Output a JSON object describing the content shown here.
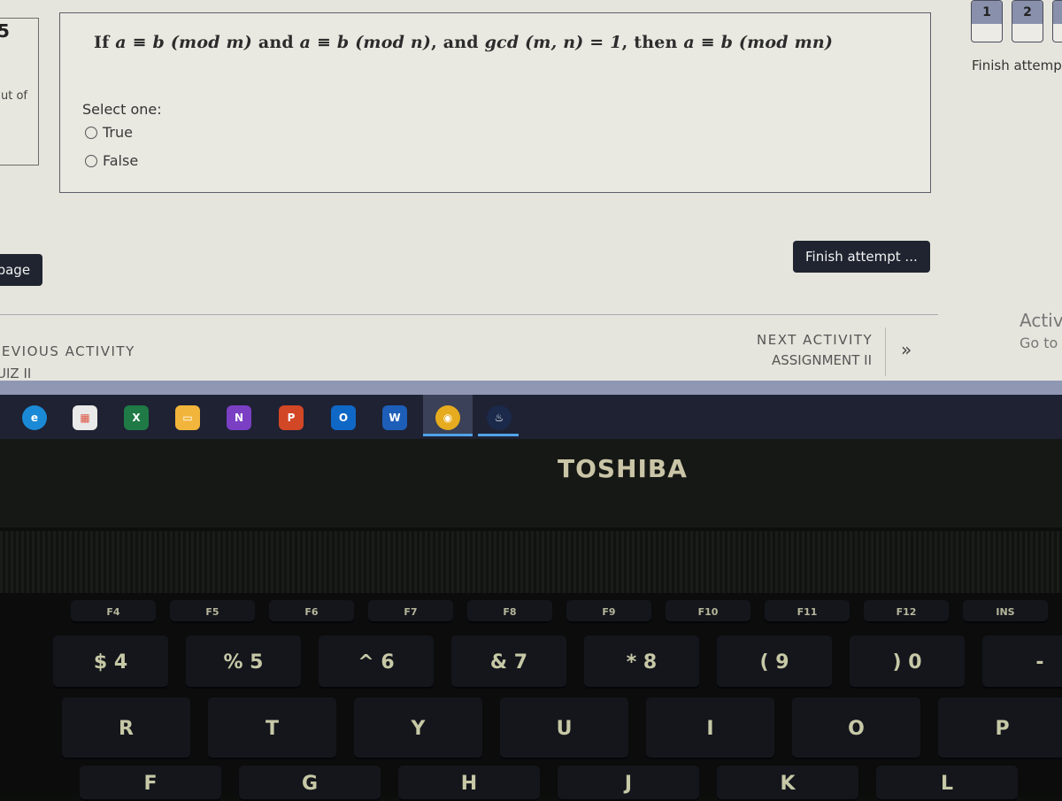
{
  "quiz": {
    "side_panel": {
      "question_number": "5",
      "out_of_label": "ut of"
    },
    "question": {
      "text_parts": [
        {
          "t": "If ",
          "style": "plain"
        },
        {
          "t": "a ≡ b (mod m)",
          "style": "math"
        },
        {
          "t": " and ",
          "style": "plain"
        },
        {
          "t": "a ≡ b (mod n)",
          "style": "math"
        },
        {
          "t": ", and ",
          "style": "plain"
        },
        {
          "t": "gcd (m, n) = 1",
          "style": "math"
        },
        {
          "t": ", then ",
          "style": "plain"
        },
        {
          "t": "a ≡ b (mod mn)",
          "style": "math"
        }
      ],
      "select_label": "Select one:",
      "options": [
        {
          "label": "True",
          "selected": false
        },
        {
          "label": "False",
          "selected": false
        }
      ]
    },
    "navigation": {
      "question_buttons": [
        "1",
        "2"
      ],
      "finish_link": "Finish attemp"
    },
    "previous_page_button": "s page",
    "finish_attempt_button": "Finish attempt ...",
    "previous_activity": {
      "heading": "REVIOUS ACTIVITY",
      "name": "UIZ II"
    },
    "next_activity": {
      "heading": "NEXT ACTIVITY",
      "name": "ASSIGNMENT II",
      "arrow": "»"
    },
    "activate_windows": {
      "title": "Activ",
      "subtitle": "Go to"
    }
  },
  "taskbar": {
    "apps": [
      {
        "name": "edge-icon",
        "glyph": "e",
        "color": "#1b8ad6"
      },
      {
        "name": "store-icon",
        "glyph": "▦",
        "color": "#e9e9e9"
      },
      {
        "name": "excel-icon",
        "glyph": "X",
        "color": "#1f7a45"
      },
      {
        "name": "file-explorer-icon",
        "glyph": "▭",
        "color": "#f2b53b"
      },
      {
        "name": "onenote-icon",
        "glyph": "N",
        "color": "#7b3fc4"
      },
      {
        "name": "powerpoint-icon",
        "glyph": "P",
        "color": "#d24726"
      },
      {
        "name": "outlook-icon",
        "glyph": "O",
        "color": "#1068c6"
      },
      {
        "name": "word-icon",
        "glyph": "W",
        "color": "#1d5fb8"
      },
      {
        "name": "chrome-icon",
        "glyph": "◉",
        "color": "#e6ab1e"
      },
      {
        "name": "steam-icon",
        "glyph": "♨",
        "color": "#1b2a4b"
      }
    ]
  },
  "laptop": {
    "brand": "TOSHIBA",
    "function_keys": [
      "F4",
      "F5",
      "F6",
      "F7",
      "F8",
      "F9",
      "F10",
      "F11",
      "F12",
      "INS"
    ],
    "number_keys": [
      "$ 4",
      "% 5",
      "^ 6",
      "& 7",
      "* 8",
      "( 9",
      ") 0",
      "-"
    ],
    "letter_row_1": [
      "R",
      "T",
      "Y",
      "U",
      "I",
      "O",
      "P"
    ],
    "letter_row_2": [
      "F",
      "G",
      "H",
      "J",
      "K",
      "L"
    ]
  }
}
